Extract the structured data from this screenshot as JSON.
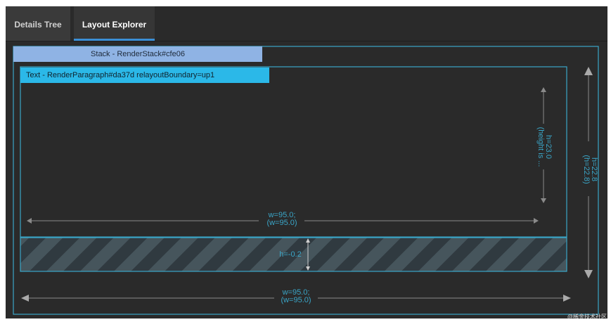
{
  "tabs": [
    {
      "label": "Details Tree",
      "active": false
    },
    {
      "label": "Layout Explorer",
      "active": true
    }
  ],
  "stack": {
    "label": "Stack - RenderStack#cfe06"
  },
  "text_node": {
    "label": "Text - RenderParagraph#da37d relayoutBoundary=up1"
  },
  "dims": {
    "inner_width": "w=95.0;",
    "inner_width_sub": "(w=95.0)",
    "inner_height": "h=23.0",
    "inner_height_sub": "(height is ...",
    "outer_height": "h=22.8",
    "outer_height_sub": "(h=22.8)",
    "overflow_height": "h=-0.2",
    "outer_width": "w=95.0;",
    "outer_width_sub": "(w=95.0)"
  },
  "watermark": "@稀金技术社区",
  "colors": {
    "stack_bg": "#8fb3e4",
    "text_bg": "#2bb8e8",
    "accent": "#3aa6c8",
    "tab_indicator": "#3b8fd6"
  }
}
